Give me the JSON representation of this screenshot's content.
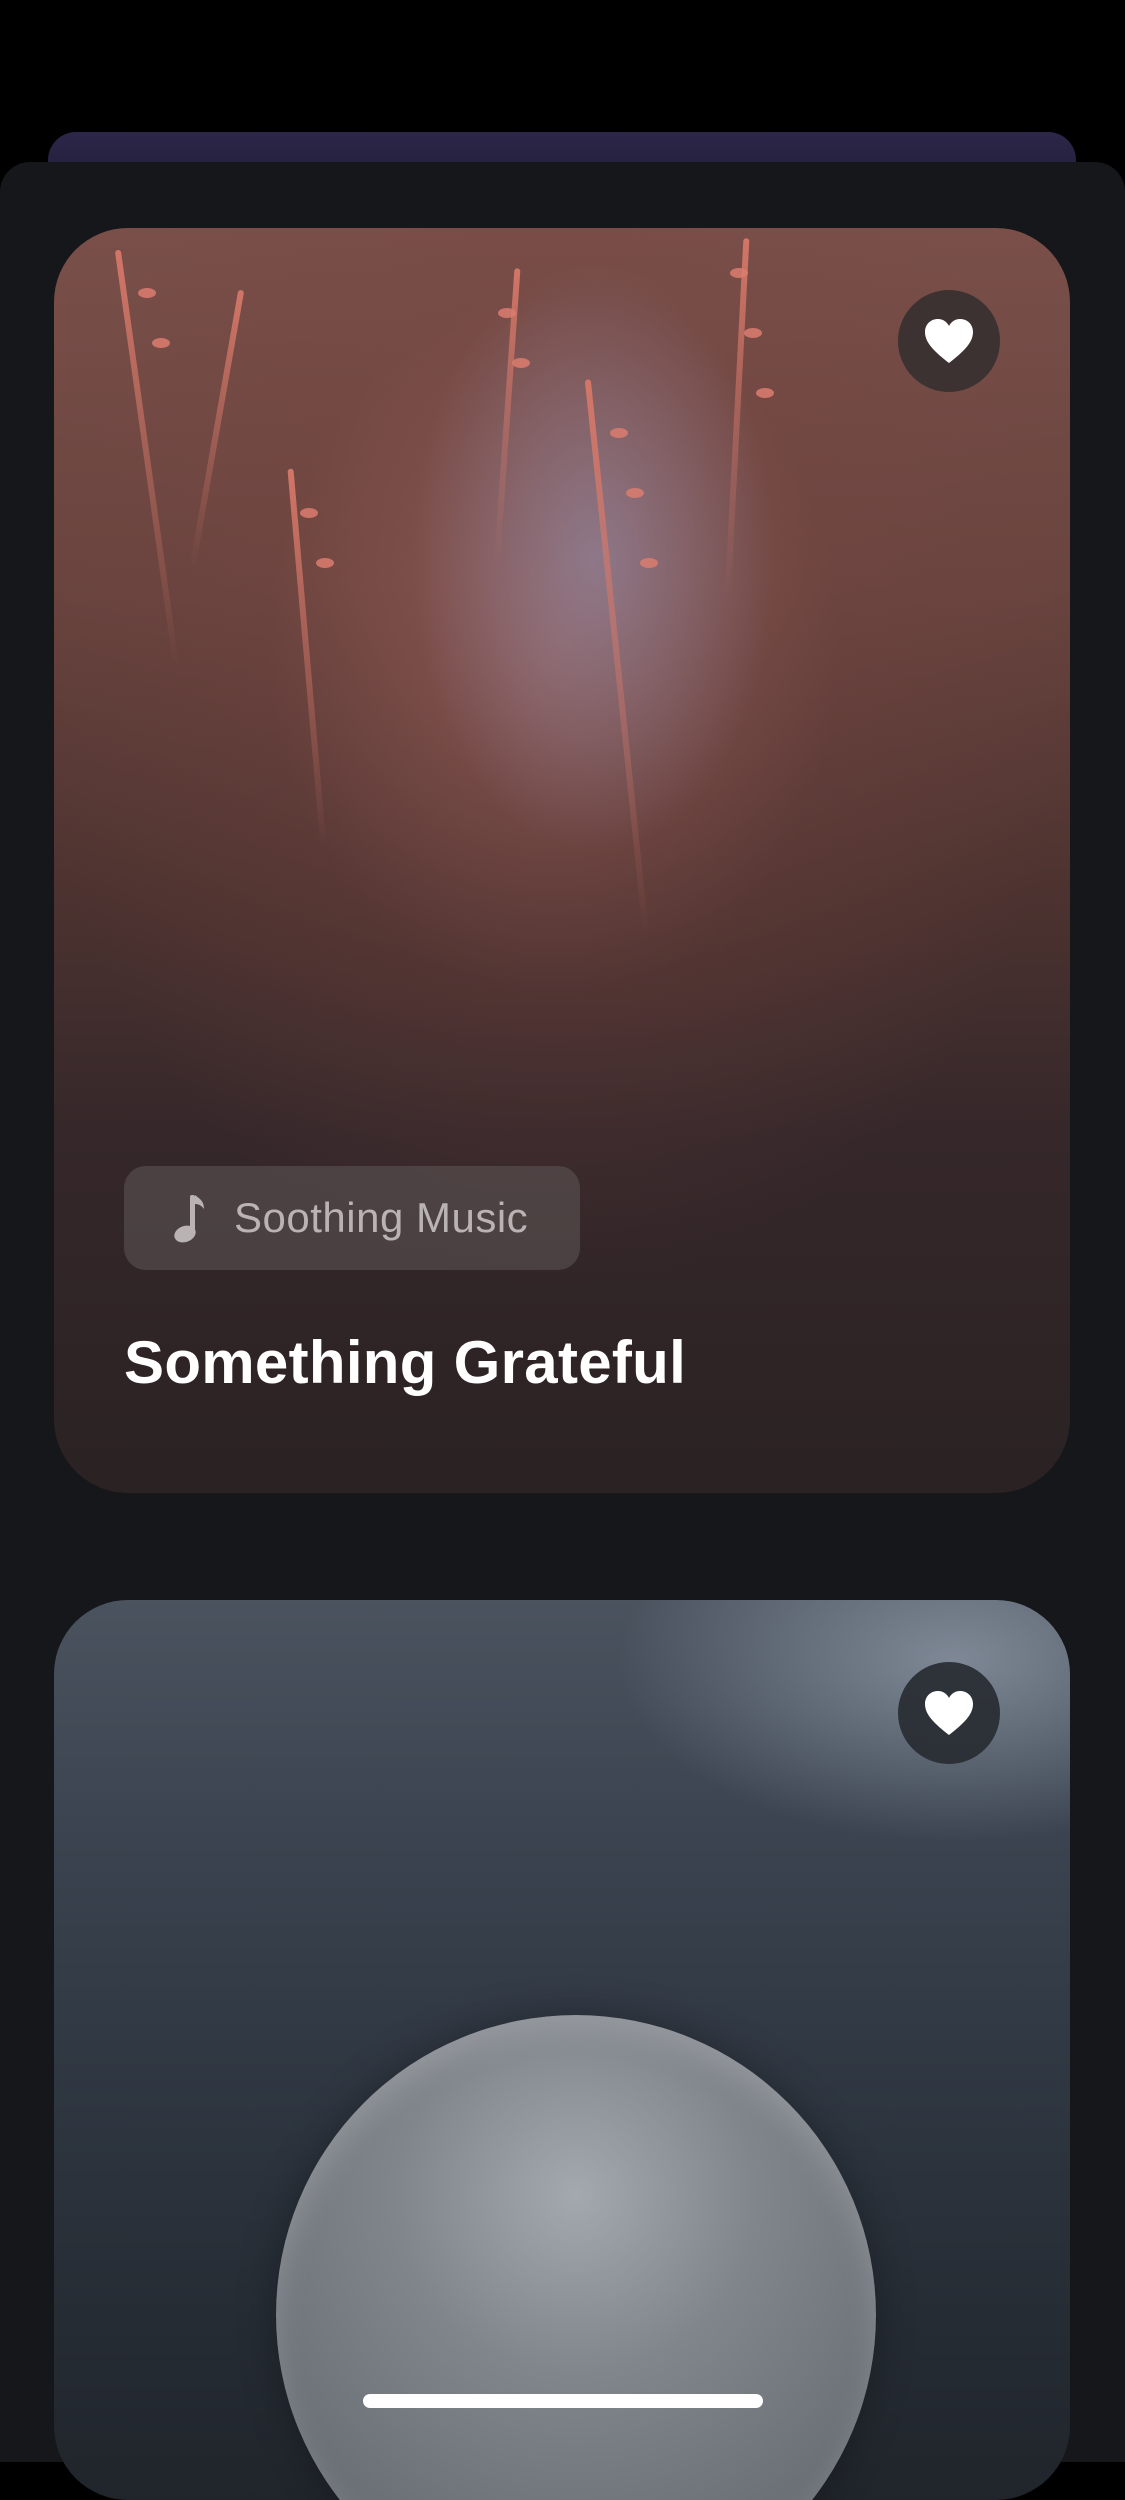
{
  "cards": [
    {
      "category_label": "Soothing Music",
      "category_icon": "music-note-icon",
      "title": "Something Grateful",
      "favorite_icon": "heart-icon"
    },
    {
      "favorite_icon": "heart-icon"
    }
  ],
  "colors": {
    "background": "#000000",
    "sheet": "#16171a",
    "title_text": "#ffffff",
    "chip_text": "#b9b3b3"
  }
}
